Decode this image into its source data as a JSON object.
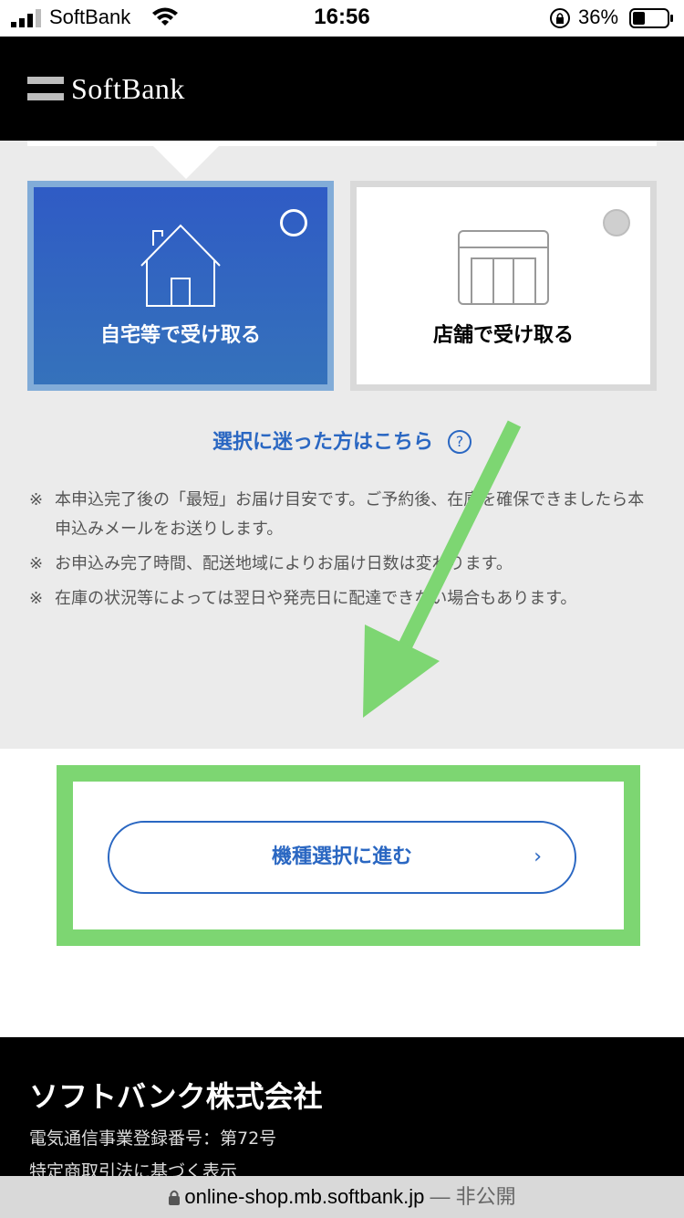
{
  "status_bar": {
    "carrier": "SoftBank",
    "time": "16:56",
    "battery_percent": "36%",
    "battery_level": 0.36
  },
  "header": {
    "logo_text": "SoftBank"
  },
  "delivery_options": [
    {
      "label": "自宅等で受け取る",
      "icon": "house-icon",
      "selected": true
    },
    {
      "label": "店舗で受け取る",
      "icon": "store-icon",
      "selected": false
    }
  ],
  "help_link": {
    "label": "選択に迷った方はこちら",
    "icon": "?"
  },
  "notes": [
    {
      "mark": "※",
      "text": "本申込完了後の「最短」お届け目安です。ご予約後、在庫を確保できましたら本申込みメールをお送りします。"
    },
    {
      "mark": "※",
      "text": "お申込み完了時間、配送地域によりお届け日数は変わります。"
    },
    {
      "mark": "※",
      "text": "在庫の状況等によっては翌日や発売日に配達できない場合もあります。"
    }
  ],
  "proceed_button": {
    "label": "機種選択に進む",
    "chevron": "›"
  },
  "footer": {
    "company": "ソフトバンク株式会社",
    "registration": "電気通信事業登録番号：第72号",
    "law_notice": "特定商取引法に基づく表示"
  },
  "url_bar": {
    "domain": "online-shop.mb.softbank.jp",
    "suffix": " — 非公開"
  },
  "colors": {
    "accent_blue": "#2a67c2",
    "highlight_green": "#7dd672",
    "header_black": "#000000"
  }
}
